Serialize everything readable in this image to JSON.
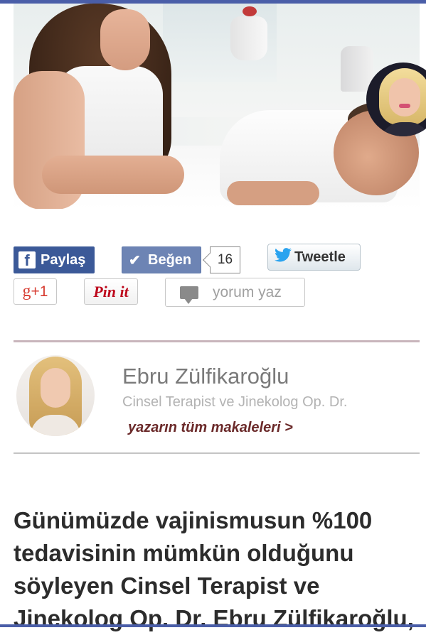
{
  "social": {
    "facebook_share": {
      "icon": "facebook-icon",
      "label": "Paylaş"
    },
    "facebook_like": {
      "icon": "check-icon",
      "label": "Beğen",
      "count": "16"
    },
    "twitter": {
      "icon": "twitter-bird-icon",
      "label": "Tweetle"
    },
    "google_plus": {
      "label": "+1"
    },
    "pinterest": {
      "label": "Pin it"
    },
    "comment": {
      "icon": "comment-bubble-icon",
      "label": "yorum yaz"
    }
  },
  "author": {
    "name": "Ebru Zülfikaroğlu",
    "title": "Cinsel Terapist ve Jinekolog Op. Dr.",
    "all_articles_link": "yazarın tüm makaleleri >"
  },
  "article": {
    "headline_lines": [
      "Günümüzde vajinismusun %100",
      "tedavisinin mümkün olduğunu",
      "söyleyen Cinsel Terapist ve",
      "Jinekolog Op. Dr. Ebru Zülfikaroğlu,"
    ]
  },
  "colors": {
    "accent_bar": "#4a5ea8",
    "facebook": "#3b5998",
    "like": "#6d84b4",
    "author_link": "#6b2a2a"
  }
}
